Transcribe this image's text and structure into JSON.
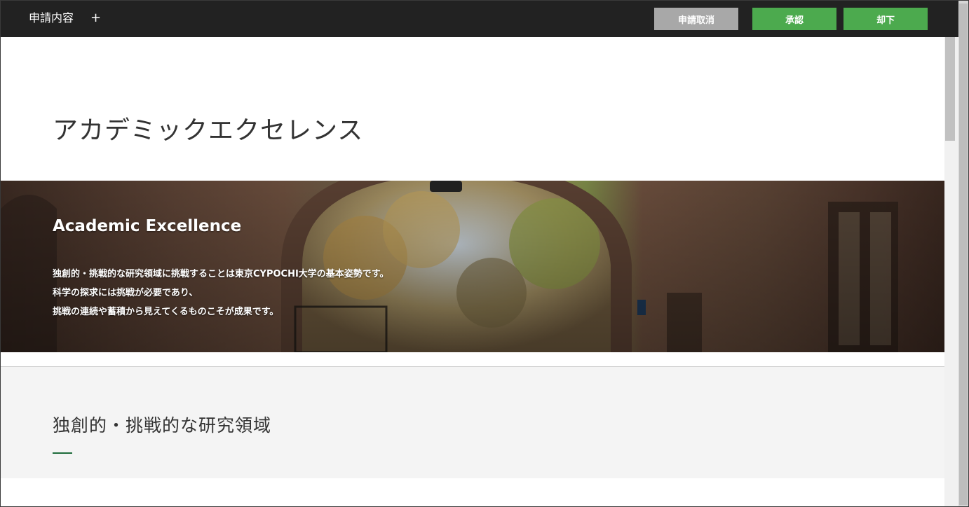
{
  "header": {
    "title": "申請内容",
    "add_label": "+",
    "cancel_label": "申請取消",
    "approve_label": "承認",
    "reject_label": "却下"
  },
  "main": {
    "page_title": "アカデミックエクセレンス",
    "hero": {
      "title": "Academic Excellence",
      "lines": [
        "独創的・挑戦的な研究領域に挑戦することは東京CYPOCHI大学の基本姿勢です。",
        "科学の探求には挑戦が必要であり、",
        "挑戦の連続や蓄積から見えてくるものこそが成果です。"
      ]
    },
    "section_title": "独創的・挑戦的な研究領域"
  },
  "colors": {
    "topbar": "#222222",
    "button_gray": "#a8a8a8",
    "button_green": "#4caa4e",
    "accent_underline": "#1d6b3a",
    "section_bg": "#f4f4f4"
  }
}
